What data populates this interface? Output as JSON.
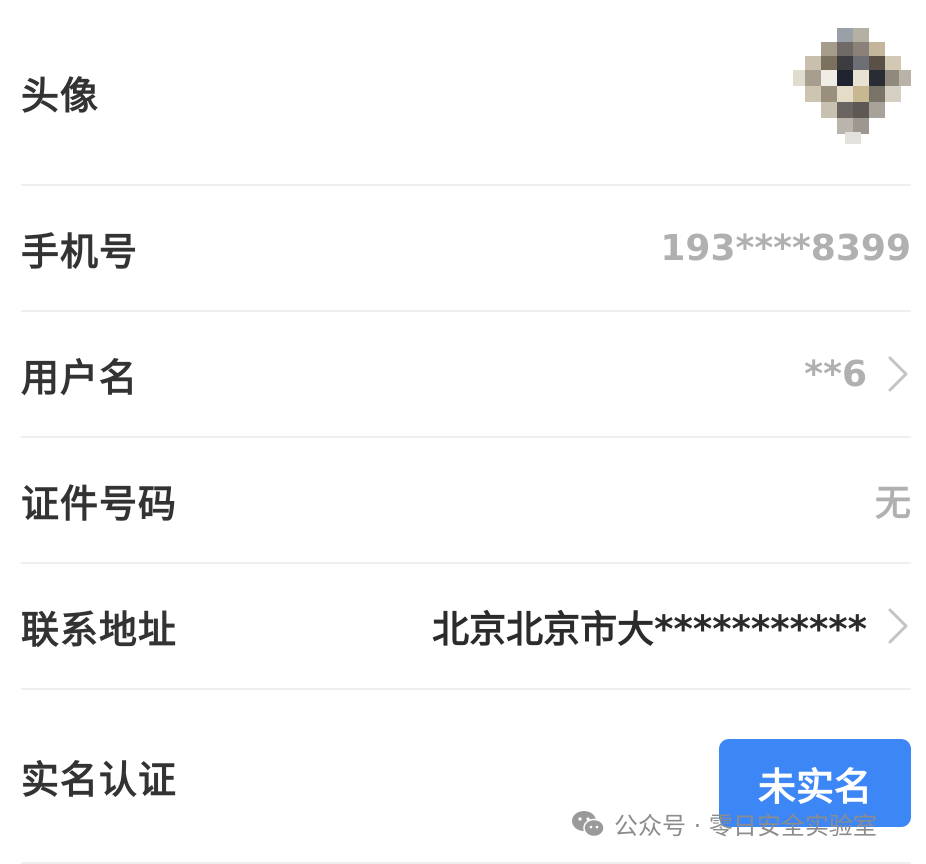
{
  "profile": {
    "avatar": {
      "label": "头像"
    },
    "phone": {
      "label": "手机号",
      "value": "193****8399"
    },
    "username": {
      "label": "用户名",
      "value": "**6"
    },
    "id_number": {
      "label": "证件号码",
      "value": "无"
    },
    "address": {
      "label": "联系地址",
      "value": "北京北京市大***********"
    },
    "verification": {
      "label": "实名认证",
      "status": "未实名"
    }
  },
  "watermark": {
    "text": "公众号 · 零日安全实验室"
  },
  "colors": {
    "accent": "#3d86f6",
    "label_text": "#333333",
    "muted_value": "#b0b0b0",
    "divider": "#efefef"
  },
  "icons": [
    "chevron-right-icon",
    "wechat-icon"
  ]
}
